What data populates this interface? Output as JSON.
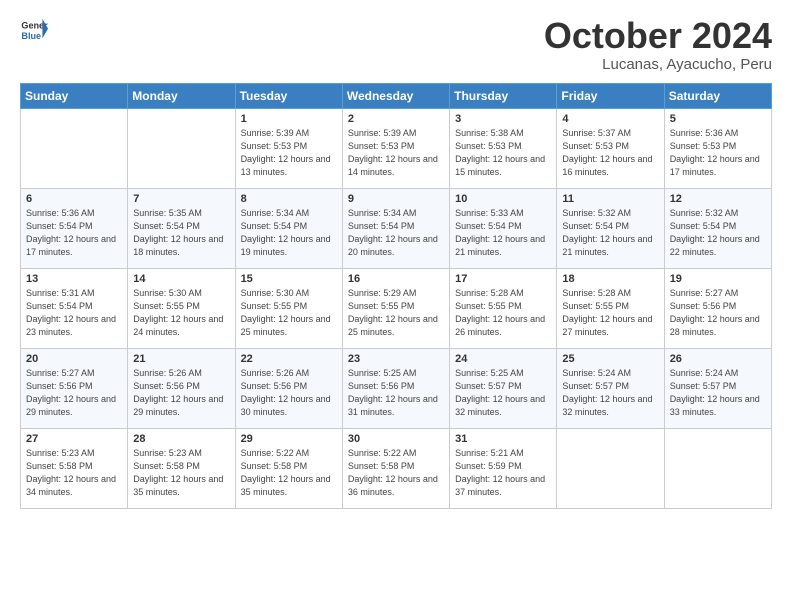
{
  "logo": {
    "general": "General",
    "blue": "Blue"
  },
  "header": {
    "month": "October 2024",
    "location": "Lucanas, Ayacucho, Peru"
  },
  "weekdays": [
    "Sunday",
    "Monday",
    "Tuesday",
    "Wednesday",
    "Thursday",
    "Friday",
    "Saturday"
  ],
  "weeks": [
    [
      {
        "day": "",
        "sunrise": "",
        "sunset": "",
        "daylight": ""
      },
      {
        "day": "",
        "sunrise": "",
        "sunset": "",
        "daylight": ""
      },
      {
        "day": "1",
        "sunrise": "Sunrise: 5:39 AM",
        "sunset": "Sunset: 5:53 PM",
        "daylight": "Daylight: 12 hours and 13 minutes."
      },
      {
        "day": "2",
        "sunrise": "Sunrise: 5:39 AM",
        "sunset": "Sunset: 5:53 PM",
        "daylight": "Daylight: 12 hours and 14 minutes."
      },
      {
        "day": "3",
        "sunrise": "Sunrise: 5:38 AM",
        "sunset": "Sunset: 5:53 PM",
        "daylight": "Daylight: 12 hours and 15 minutes."
      },
      {
        "day": "4",
        "sunrise": "Sunrise: 5:37 AM",
        "sunset": "Sunset: 5:53 PM",
        "daylight": "Daylight: 12 hours and 16 minutes."
      },
      {
        "day": "5",
        "sunrise": "Sunrise: 5:36 AM",
        "sunset": "Sunset: 5:53 PM",
        "daylight": "Daylight: 12 hours and 17 minutes."
      }
    ],
    [
      {
        "day": "6",
        "sunrise": "Sunrise: 5:36 AM",
        "sunset": "Sunset: 5:54 PM",
        "daylight": "Daylight: 12 hours and 17 minutes."
      },
      {
        "day": "7",
        "sunrise": "Sunrise: 5:35 AM",
        "sunset": "Sunset: 5:54 PM",
        "daylight": "Daylight: 12 hours and 18 minutes."
      },
      {
        "day": "8",
        "sunrise": "Sunrise: 5:34 AM",
        "sunset": "Sunset: 5:54 PM",
        "daylight": "Daylight: 12 hours and 19 minutes."
      },
      {
        "day": "9",
        "sunrise": "Sunrise: 5:34 AM",
        "sunset": "Sunset: 5:54 PM",
        "daylight": "Daylight: 12 hours and 20 minutes."
      },
      {
        "day": "10",
        "sunrise": "Sunrise: 5:33 AM",
        "sunset": "Sunset: 5:54 PM",
        "daylight": "Daylight: 12 hours and 21 minutes."
      },
      {
        "day": "11",
        "sunrise": "Sunrise: 5:32 AM",
        "sunset": "Sunset: 5:54 PM",
        "daylight": "Daylight: 12 hours and 21 minutes."
      },
      {
        "day": "12",
        "sunrise": "Sunrise: 5:32 AM",
        "sunset": "Sunset: 5:54 PM",
        "daylight": "Daylight: 12 hours and 22 minutes."
      }
    ],
    [
      {
        "day": "13",
        "sunrise": "Sunrise: 5:31 AM",
        "sunset": "Sunset: 5:54 PM",
        "daylight": "Daylight: 12 hours and 23 minutes."
      },
      {
        "day": "14",
        "sunrise": "Sunrise: 5:30 AM",
        "sunset": "Sunset: 5:55 PM",
        "daylight": "Daylight: 12 hours and 24 minutes."
      },
      {
        "day": "15",
        "sunrise": "Sunrise: 5:30 AM",
        "sunset": "Sunset: 5:55 PM",
        "daylight": "Daylight: 12 hours and 25 minutes."
      },
      {
        "day": "16",
        "sunrise": "Sunrise: 5:29 AM",
        "sunset": "Sunset: 5:55 PM",
        "daylight": "Daylight: 12 hours and 25 minutes."
      },
      {
        "day": "17",
        "sunrise": "Sunrise: 5:28 AM",
        "sunset": "Sunset: 5:55 PM",
        "daylight": "Daylight: 12 hours and 26 minutes."
      },
      {
        "day": "18",
        "sunrise": "Sunrise: 5:28 AM",
        "sunset": "Sunset: 5:55 PM",
        "daylight": "Daylight: 12 hours and 27 minutes."
      },
      {
        "day": "19",
        "sunrise": "Sunrise: 5:27 AM",
        "sunset": "Sunset: 5:56 PM",
        "daylight": "Daylight: 12 hours and 28 minutes."
      }
    ],
    [
      {
        "day": "20",
        "sunrise": "Sunrise: 5:27 AM",
        "sunset": "Sunset: 5:56 PM",
        "daylight": "Daylight: 12 hours and 29 minutes."
      },
      {
        "day": "21",
        "sunrise": "Sunrise: 5:26 AM",
        "sunset": "Sunset: 5:56 PM",
        "daylight": "Daylight: 12 hours and 29 minutes."
      },
      {
        "day": "22",
        "sunrise": "Sunrise: 5:26 AM",
        "sunset": "Sunset: 5:56 PM",
        "daylight": "Daylight: 12 hours and 30 minutes."
      },
      {
        "day": "23",
        "sunrise": "Sunrise: 5:25 AM",
        "sunset": "Sunset: 5:56 PM",
        "daylight": "Daylight: 12 hours and 31 minutes."
      },
      {
        "day": "24",
        "sunrise": "Sunrise: 5:25 AM",
        "sunset": "Sunset: 5:57 PM",
        "daylight": "Daylight: 12 hours and 32 minutes."
      },
      {
        "day": "25",
        "sunrise": "Sunrise: 5:24 AM",
        "sunset": "Sunset: 5:57 PM",
        "daylight": "Daylight: 12 hours and 32 minutes."
      },
      {
        "day": "26",
        "sunrise": "Sunrise: 5:24 AM",
        "sunset": "Sunset: 5:57 PM",
        "daylight": "Daylight: 12 hours and 33 minutes."
      }
    ],
    [
      {
        "day": "27",
        "sunrise": "Sunrise: 5:23 AM",
        "sunset": "Sunset: 5:58 PM",
        "daylight": "Daylight: 12 hours and 34 minutes."
      },
      {
        "day": "28",
        "sunrise": "Sunrise: 5:23 AM",
        "sunset": "Sunset: 5:58 PM",
        "daylight": "Daylight: 12 hours and 35 minutes."
      },
      {
        "day": "29",
        "sunrise": "Sunrise: 5:22 AM",
        "sunset": "Sunset: 5:58 PM",
        "daylight": "Daylight: 12 hours and 35 minutes."
      },
      {
        "day": "30",
        "sunrise": "Sunrise: 5:22 AM",
        "sunset": "Sunset: 5:58 PM",
        "daylight": "Daylight: 12 hours and 36 minutes."
      },
      {
        "day": "31",
        "sunrise": "Sunrise: 5:21 AM",
        "sunset": "Sunset: 5:59 PM",
        "daylight": "Daylight: 12 hours and 37 minutes."
      },
      {
        "day": "",
        "sunrise": "",
        "sunset": "",
        "daylight": ""
      },
      {
        "day": "",
        "sunrise": "",
        "sunset": "",
        "daylight": ""
      }
    ]
  ]
}
